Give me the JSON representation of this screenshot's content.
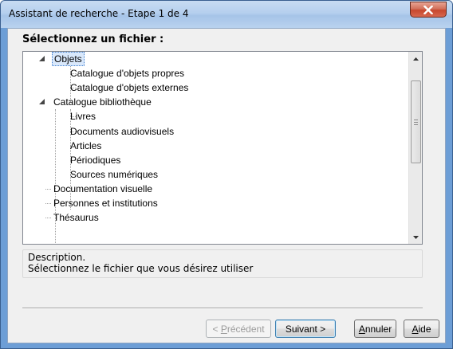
{
  "window": {
    "title": "Assistant de recherche - Etape 1 de 4"
  },
  "prompt": "Sélectionnez un fichier :",
  "tree": {
    "items": [
      {
        "label": "Objets",
        "level": 0,
        "expanded": true,
        "selected": true
      },
      {
        "label": "Catalogue d'objets propres",
        "level": 1
      },
      {
        "label": "Catalogue d'objets externes",
        "level": 1
      },
      {
        "label": "Catalogue bibliothèque",
        "level": 0,
        "expanded": true
      },
      {
        "label": "Livres",
        "level": 1
      },
      {
        "label": "Documents audiovisuels",
        "level": 1
      },
      {
        "label": "Articles",
        "level": 1
      },
      {
        "label": "Périodiques",
        "level": 1
      },
      {
        "label": "Sources numériques",
        "level": 1
      },
      {
        "label": "Documentation visuelle",
        "level": 0
      },
      {
        "label": "Personnes et institutions",
        "level": 0
      },
      {
        "label": "Thésaurus",
        "level": 0
      }
    ]
  },
  "description": {
    "heading": "Description.",
    "text": "Sélectionnez le fichier que vous désirez utiliser"
  },
  "buttons": {
    "previous": {
      "prefix": "< ",
      "mnemonic": "P",
      "rest": "récédent"
    },
    "next": "Suivant >",
    "cancel": {
      "mnemonic": "A",
      "rest": "nnuler"
    },
    "help": {
      "mnemonic": "A",
      "rest": "ide"
    }
  }
}
